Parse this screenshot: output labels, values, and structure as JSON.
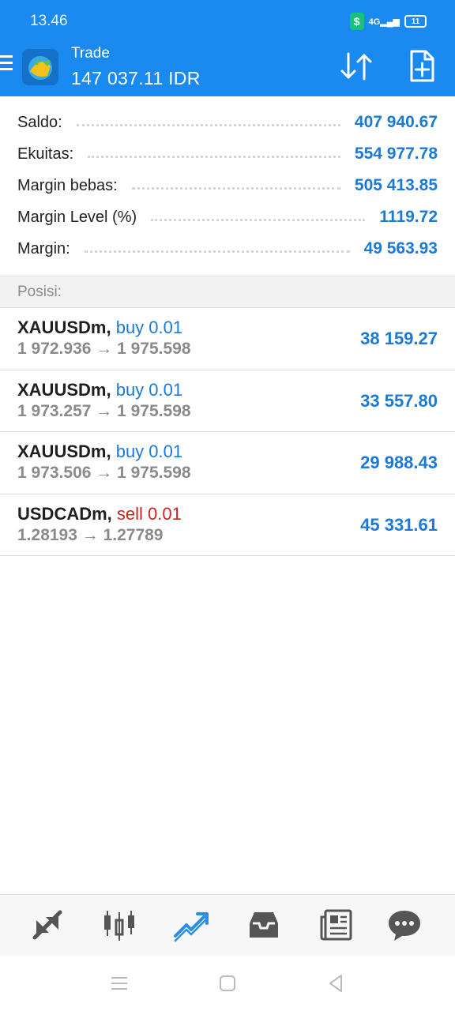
{
  "status_bar": {
    "time": "13.46",
    "network": "4G",
    "battery": "11"
  },
  "header": {
    "title": "Trade",
    "balance": "147 037.11 IDR"
  },
  "account": [
    {
      "label": "Saldo:",
      "value": "407 940.67"
    },
    {
      "label": "Ekuitas:",
      "value": "554 977.78"
    },
    {
      "label": "Margin bebas:",
      "value": "505 413.85"
    },
    {
      "label": "Margin Level (%)",
      "value": "1119.72"
    },
    {
      "label": "Margin:",
      "value": "49 563.93"
    }
  ],
  "positions_header": "Posisi:",
  "positions": [
    {
      "symbol": "XAUUSDm,",
      "side": "buy 0.01",
      "prices": "1 972.936 → 1 975.598",
      "profit": "38 159.27"
    },
    {
      "symbol": "XAUUSDm,",
      "side": "buy 0.01",
      "prices": "1 973.257 → 1 975.598",
      "profit": "33 557.80"
    },
    {
      "symbol": "XAUUSDm,",
      "side": "buy 0.01",
      "prices": "1 973.506 → 1 975.598",
      "profit": "29 988.43"
    },
    {
      "symbol": "USDCADm,",
      "side": "sell 0.01",
      "prices": "1.28193 → 1.27789",
      "profit": "45 331.61"
    }
  ],
  "bottom_nav": [
    "quotes-icon",
    "chart-candles-icon",
    "trade-icon",
    "history-inbox-icon",
    "news-icon",
    "chat-icon"
  ],
  "colors": {
    "header_blue": "#1a8af0",
    "value_blue": "#1a7ad6",
    "sell_red": "#cc2222",
    "nav_active": "#2a8ee6",
    "nav_inactive": "#555555"
  }
}
